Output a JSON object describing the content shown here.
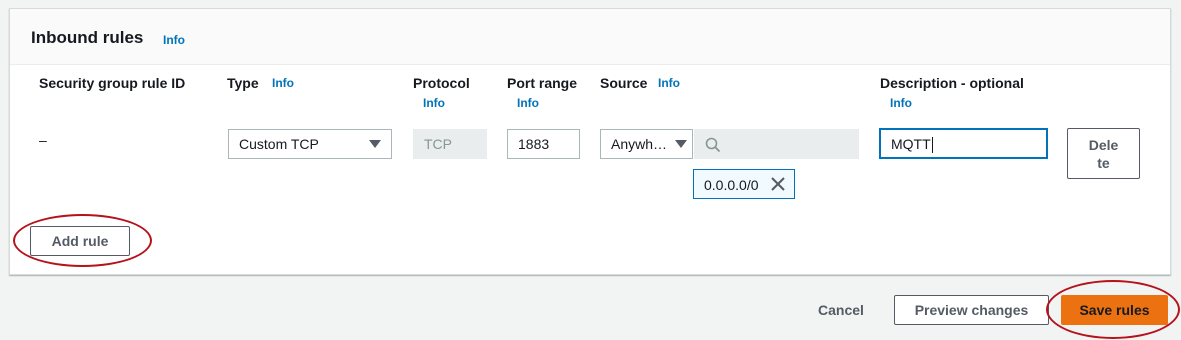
{
  "panel": {
    "title": "Inbound rules",
    "info": "Info"
  },
  "columns": {
    "rule_id": "Security group rule ID",
    "type": "Type",
    "protocol": "Protocol",
    "port_range": "Port range",
    "source": "Source",
    "description": "Description - optional",
    "info": "Info"
  },
  "row": {
    "rule_id": "–",
    "type": "Custom TCP",
    "protocol": "TCP",
    "port_range": "1883",
    "source_type": "Anywh…",
    "source_search_placeholder": "",
    "source_token": "0.0.0.0/0",
    "description": "MQTT",
    "delete_label_1": "Dele",
    "delete_label_2": "te"
  },
  "actions": {
    "add_rule": "Add rule",
    "cancel": "Cancel",
    "preview": "Preview changes",
    "save": "Save rules"
  },
  "colors": {
    "primary": "#ec7211",
    "link": "#0073bb",
    "annotation": "#b5121b"
  },
  "icons": [
    "chevron-down-icon",
    "search-icon",
    "close-icon"
  ]
}
